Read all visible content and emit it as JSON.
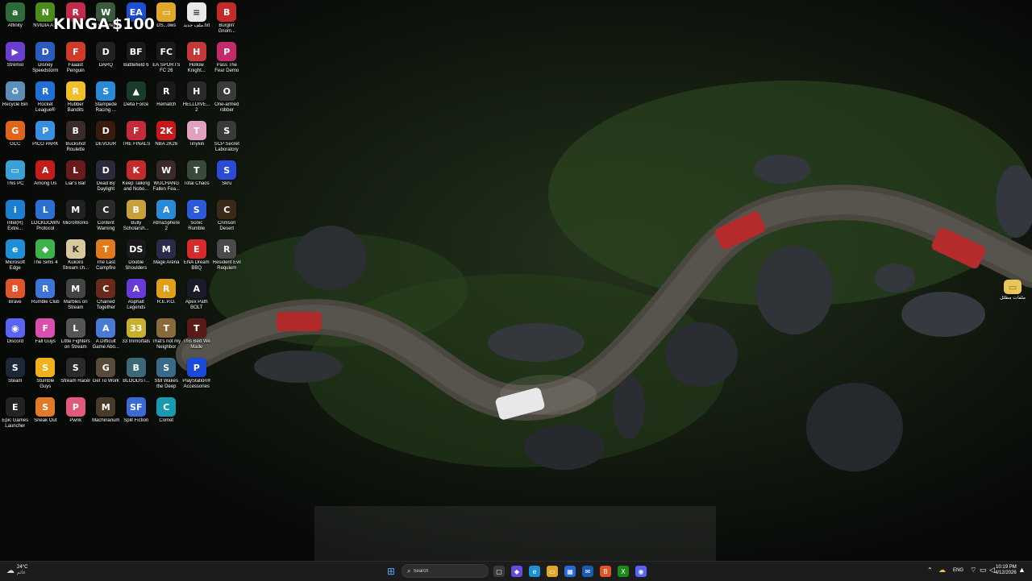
{
  "desktop": {
    "icons": [
      {
        "label": "Affinity",
        "bg": "#2d6b3a",
        "glyph": "a"
      },
      {
        "label": "Stremio",
        "bg": "#6a3fd0",
        "glyph": "▶"
      },
      {
        "label": "Recycle Bin",
        "bg": "#5b8fb9",
        "glyph": "♻"
      },
      {
        "label": "GCC",
        "bg": "#e0641c",
        "glyph": "G"
      },
      {
        "label": "This PC",
        "bg": "#3aa0d8",
        "glyph": "▭"
      },
      {
        "label": "Intel(R) Extre...",
        "bg": "#1a7fd0",
        "glyph": "i"
      },
      {
        "label": "Microsoft Edge",
        "bg": "#1c8fd6",
        "glyph": "e"
      },
      {
        "label": "Brave",
        "bg": "#e0542a",
        "glyph": "B"
      },
      {
        "label": "Discord",
        "bg": "#5865f2",
        "glyph": "◉"
      },
      {
        "label": "Steam",
        "bg": "#1b2838",
        "glyph": "S"
      },
      {
        "label": "Epic Games Launcher",
        "bg": "#222222",
        "glyph": "E"
      },
      {
        "label": "NVIDIA A...",
        "bg": "#4a8d1a",
        "glyph": "N"
      },
      {
        "label": "Disney Speedstorm",
        "bg": "#2a5bbf",
        "glyph": "D"
      },
      {
        "label": "Rocket League®",
        "bg": "#1e6fd6",
        "glyph": "R"
      },
      {
        "label": "PICO PARK",
        "bg": "#3a8ee0",
        "glyph": "P"
      },
      {
        "label": "Among Us",
        "bg": "#c41b1b",
        "glyph": "A"
      },
      {
        "label": "LOCKDOWN Protocol",
        "bg": "#2b6fd0",
        "glyph": "L"
      },
      {
        "label": "The Sims 4",
        "bg": "#3bb24a",
        "glyph": "◆"
      },
      {
        "label": "Rumble Club",
        "bg": "#3d74d8",
        "glyph": "R"
      },
      {
        "label": "Fall Guys",
        "bg": "#d84fb0",
        "glyph": "F"
      },
      {
        "label": "Stumble Guys",
        "bg": "#f0b21c",
        "glyph": "S"
      },
      {
        "label": "Sneak Out",
        "bg": "#e07a2a",
        "glyph": "S"
      },
      {
        "label": "",
        "bg": "#c42b4a",
        "glyph": "R"
      },
      {
        "label": "Faaast Penguin",
        "bg": "#d03a2a",
        "glyph": "F"
      },
      {
        "label": "Rubber Bandits",
        "bg": "#f0c02a",
        "glyph": "R"
      },
      {
        "label": "Buckshot Roulette",
        "bg": "#3a2a2a",
        "glyph": "B"
      },
      {
        "label": "Liar's Bar",
        "bg": "#6a1a1a",
        "glyph": "L"
      },
      {
        "label": "MicroWorks",
        "bg": "#222222",
        "glyph": "M"
      },
      {
        "label": "Kukoro Stream ch...",
        "bg": "#d8c8a0",
        "glyph": "K"
      },
      {
        "label": "Marbles on Stream",
        "bg": "#444444",
        "glyph": "M"
      },
      {
        "label": "Little Fighters on Stream",
        "bg": "#555555",
        "glyph": "L"
      },
      {
        "label": "Stream Racer",
        "bg": "#2a2a2a",
        "glyph": "S"
      },
      {
        "label": "Pwnk",
        "bg": "#e05a7a",
        "glyph": "P"
      },
      {
        "label": "e We Meet",
        "bg": "#3a5a3a",
        "glyph": "W"
      },
      {
        "label": "DARQ",
        "bg": "#222222",
        "glyph": "D"
      },
      {
        "label": "Stampede Racing ...",
        "bg": "#2a8ad8",
        "glyph": "S"
      },
      {
        "label": "DEVOUR",
        "bg": "#3a1a0a",
        "glyph": "D"
      },
      {
        "label": "Dead By Daylight",
        "bg": "#2a2a3a",
        "glyph": "D"
      },
      {
        "label": "Content Warning",
        "bg": "#2a2a2a",
        "glyph": "C"
      },
      {
        "label": "The Last Campfire",
        "bg": "#e07a1a",
        "glyph": "T"
      },
      {
        "label": "Chained Together",
        "bg": "#6a2a1a",
        "glyph": "C"
      },
      {
        "label": "A Difficult Game Abo...",
        "bg": "#4a7ad8",
        "glyph": "A"
      },
      {
        "label": "Get To Work",
        "bg": "#5a4a3a",
        "glyph": "G"
      },
      {
        "label": "Machinarium",
        "bg": "#4a3a2a",
        "glyph": "M"
      },
      {
        "label": "",
        "bg": "#1d4fd6",
        "glyph": "EA"
      },
      {
        "label": "Battlefield 6",
        "bg": "#1a1a1a",
        "glyph": "BF"
      },
      {
        "label": "Delta Force",
        "bg": "#1a3a2a",
        "glyph": "▲"
      },
      {
        "label": "THE FINALS",
        "bg": "#c42a3a",
        "glyph": "F"
      },
      {
        "label": "Keep Talking and Nobo...",
        "bg": "#c42a2a",
        "glyph": "K"
      },
      {
        "label": "Bully Scholarsh...",
        "bg": "#c8a03a",
        "glyph": "B"
      },
      {
        "label": "Double Shoulders",
        "bg": "#1a1a1a",
        "glyph": "DS"
      },
      {
        "label": "Asphalt Legends",
        "bg": "#6a3ad8",
        "glyph": "A"
      },
      {
        "label": "33 Immortals",
        "bg": "#c8b02a",
        "glyph": "33"
      },
      {
        "label": "BLOODST...",
        "bg": "#3a6a7a",
        "glyph": "B"
      },
      {
        "label": "Split Fiction",
        "bg": "#3a6ad8",
        "glyph": "SF"
      },
      {
        "label": "DS...ows",
        "bg": "#e0a82a",
        "glyph": "▭"
      },
      {
        "label": "EA SPORTS FC 26",
        "bg": "#1a1a1a",
        "glyph": "FC"
      },
      {
        "label": "Rematch",
        "bg": "#1a1a1a",
        "glyph": "R"
      },
      {
        "label": "NBA 2K26",
        "bg": "#c41a1a",
        "glyph": "2K"
      },
      {
        "label": "WUCHANG Fallen Fea...",
        "bg": "#3a2a2a",
        "glyph": "W"
      },
      {
        "label": "AtmaSphere 2",
        "bg": "#2a8ad8",
        "glyph": "A"
      },
      {
        "label": "Mage Arena",
        "bg": "#2a2a4a",
        "glyph": "M"
      },
      {
        "label": "R.E.P.O.",
        "bg": "#e0a01a",
        "glyph": "R"
      },
      {
        "label": "That's not my Neighbor",
        "bg": "#8a6a3a",
        "glyph": "T"
      },
      {
        "label": "Still Wakes the Deep",
        "bg": "#3a6a8a",
        "glyph": "S"
      },
      {
        "label": "Comet",
        "bg": "#1a9ab0",
        "glyph": "C"
      },
      {
        "label": "ملف جديد.txt",
        "bg": "#e8e8e8",
        "glyph": "≡"
      },
      {
        "label": "Hollow Knight...",
        "bg": "#c43a3a",
        "glyph": "H"
      },
      {
        "label": "HELLDIVE... 2",
        "bg": "#2a2a2a",
        "glyph": "H"
      },
      {
        "label": "Tinykin",
        "bg": "#e0a0c0",
        "glyph": "T"
      },
      {
        "label": "Total Chaos",
        "bg": "#3a4a3a",
        "glyph": "T"
      },
      {
        "label": "Sonic Rumble",
        "bg": "#2a5ad8",
        "glyph": "S"
      },
      {
        "label": "ENA Dream BBQ",
        "bg": "#d82a2a",
        "glyph": "E"
      },
      {
        "label": "Apex Path BOLT",
        "bg": "#1a1a2a",
        "glyph": "A"
      },
      {
        "label": "This Bed We Made",
        "bg": "#5a1a1a",
        "glyph": "T"
      },
      {
        "label": "PlayStation® Accessories",
        "bg": "#1a4ad8",
        "glyph": "P"
      },
      {
        "label": "",
        "bg": "transparent",
        "glyph": ""
      },
      {
        "label": "Burglin' Gnom...",
        "bg": "#c42a2a",
        "glyph": "B"
      },
      {
        "label": "Pass The Fear Demo",
        "bg": "#c42a6a",
        "glyph": "P"
      },
      {
        "label": "One-armed robber",
        "bg": "#3a3a3a",
        "glyph": "O"
      },
      {
        "label": "SCP Secret Laboratory",
        "bg": "#3a3a3a",
        "glyph": "S"
      },
      {
        "label": "Skru",
        "bg": "#2a4ad8",
        "glyph": "S"
      },
      {
        "label": "Crimson Desert",
        "bg": "#3a2a1a",
        "glyph": "C"
      },
      {
        "label": "Resident Evil Requiem",
        "bg": "#4a4a4a",
        "glyph": "R"
      }
    ],
    "right_folder": {
      "label": "ملفات مظلل"
    }
  },
  "overlay": {
    "name": "KINGA",
    "price": "$100"
  },
  "taskbar": {
    "weather": {
      "temp": "24°C",
      "condition": "غائم"
    },
    "search_placeholder": "Search",
    "language": "ENG",
    "time": "10:19 PM",
    "date": "4/12/2026",
    "pinned": [
      {
        "name": "start-icon",
        "glyph": "⊞",
        "bg": "transparent"
      },
      {
        "name": "task-view-icon",
        "glyph": "▢",
        "bg": "#3a3a3a"
      },
      {
        "name": "copilot-icon",
        "glyph": "◆",
        "bg": "#6a4ad8"
      },
      {
        "name": "edge-icon",
        "glyph": "e",
        "bg": "#1c8fd6"
      },
      {
        "name": "file-explorer-icon",
        "glyph": "▭",
        "bg": "#e0a82a"
      },
      {
        "name": "store-icon",
        "glyph": "▦",
        "bg": "#2a6ad8"
      },
      {
        "name": "mail-icon",
        "glyph": "✉",
        "bg": "#1a5ab0"
      },
      {
        "name": "brave-icon",
        "glyph": "B",
        "bg": "#e0542a"
      },
      {
        "name": "xbox-icon",
        "glyph": "X",
        "bg": "#1a8a1a"
      },
      {
        "name": "discord-icon",
        "glyph": "◉",
        "bg": "#5865f2"
      }
    ]
  }
}
